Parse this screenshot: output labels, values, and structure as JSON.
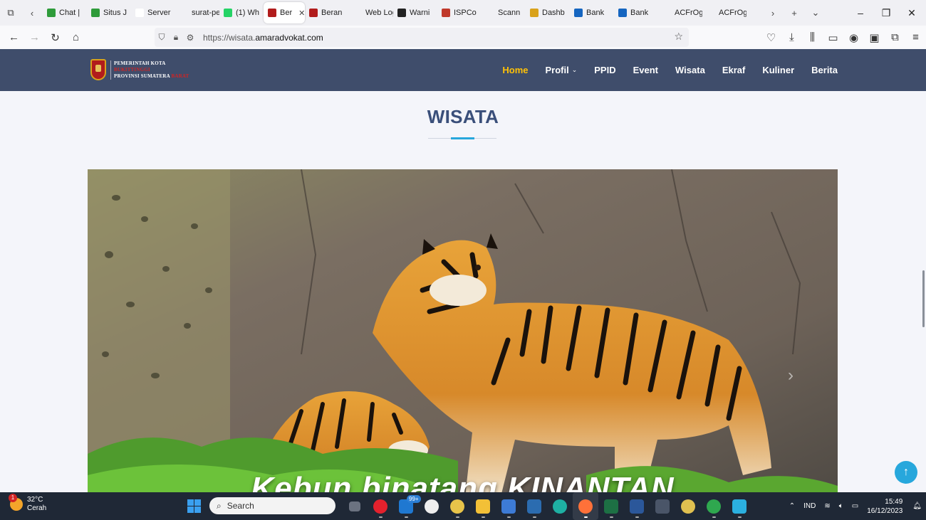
{
  "browser": {
    "tabs": [
      {
        "label": "Chat |",
        "color": "#2e9b3a"
      },
      {
        "label": "Situs J",
        "color": "#2e9b3a"
      },
      {
        "label": "Server",
        "color": "#ffffff"
      },
      {
        "label": "surat-pem",
        "color": "#f0f0f4"
      },
      {
        "label": "(1) Wh",
        "color": "#25d366"
      },
      {
        "label": "Ber",
        "color": "#b11c1c",
        "active": true
      },
      {
        "label": "Beran",
        "color": "#b11c1c"
      },
      {
        "label": "Web Logo",
        "color": "#f0f0f4"
      },
      {
        "label": "Warni",
        "color": "#222222"
      },
      {
        "label": "ISPCo",
        "color": "#c0392b"
      },
      {
        "label": "Scann",
        "color": "#f0f0f4"
      },
      {
        "label": "Dashb",
        "color": "#d9a21b"
      },
      {
        "label": "Bank",
        "color": "#1565c0"
      },
      {
        "label": "Bank",
        "color": "#1565c0"
      },
      {
        "label": "ACFrOgBF",
        "color": "#f0f0f4"
      },
      {
        "label": "ACFrOgDV",
        "color": "#f0f0f4"
      }
    ],
    "url_prefix": "https://wisata.",
    "url_domain": "amaradvokat.com"
  },
  "site": {
    "logo_line1": "PEMERINTAH KOTA",
    "logo_line2": "BUKITTINGGI",
    "logo_line3": "PROVINSI SUMATERA",
    "logo_line3b": "BARAT",
    "menu": [
      {
        "label": "Home",
        "active": true
      },
      {
        "label": "Profil",
        "dropdown": true
      },
      {
        "label": "PPID"
      },
      {
        "label": "Event"
      },
      {
        "label": "Wisata"
      },
      {
        "label": "Ekraf"
      },
      {
        "label": "Kuliner"
      },
      {
        "label": "Berita"
      }
    ],
    "section_title": "WISATA",
    "hero_caption": "Kebun binatang KINANTAN"
  },
  "taskbar": {
    "weather_temp": "32°C",
    "weather_desc": "Cerah",
    "weather_badge": "1",
    "search_label": "Search",
    "mail_badge": "99+",
    "lang": "IND",
    "time": "15:49",
    "date": "16/12/2023"
  }
}
